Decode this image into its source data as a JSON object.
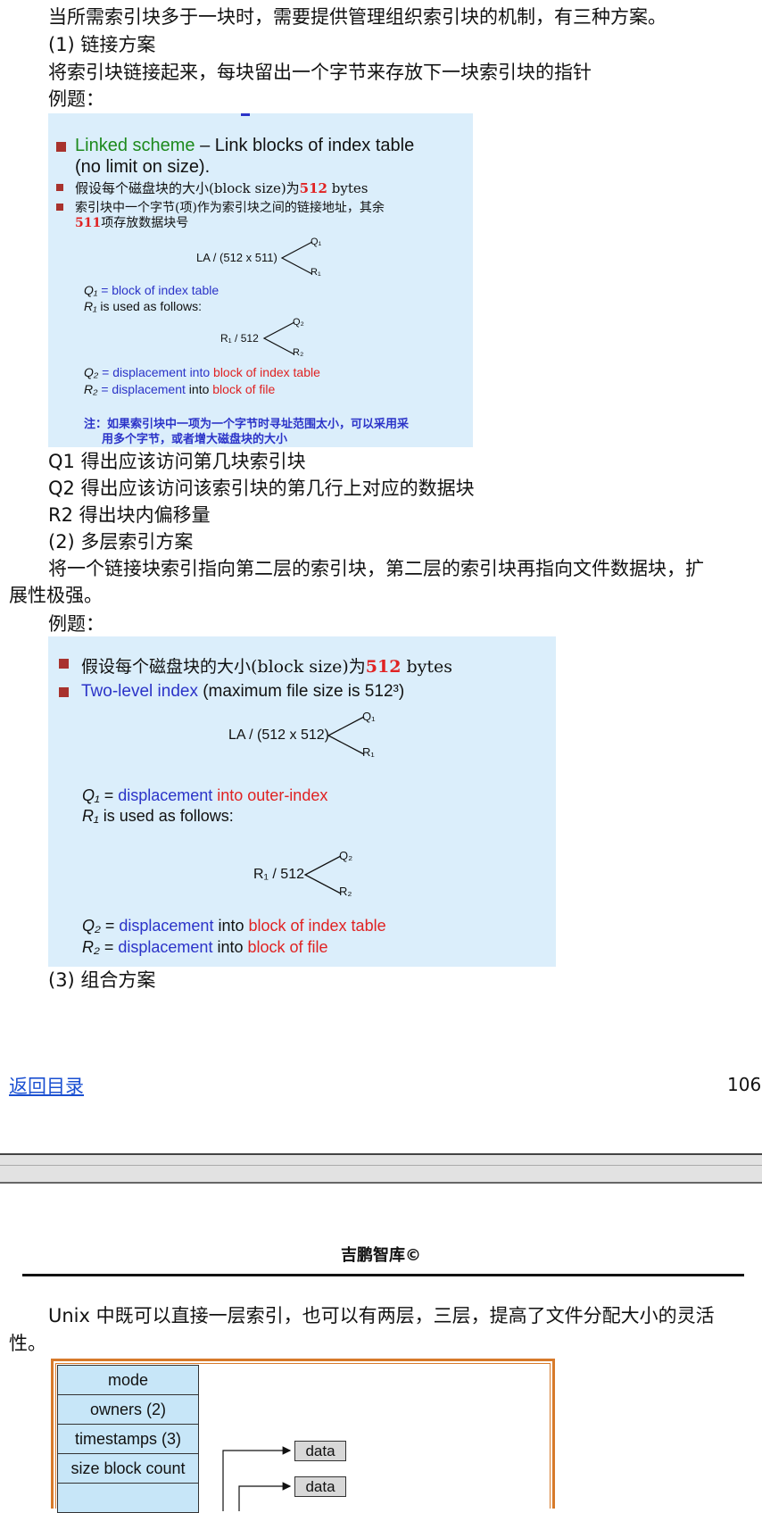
{
  "page1": {
    "intro": "当所需索引块多于一块时，需要提供管理组织索引块的机制，有三种方案。",
    "s1_title": "(1) 链接方案",
    "s1_desc": "将索引块链接起来，每块留出一个字节来存放下一块索引块的指针",
    "example1": "例题：",
    "slide1": {
      "linked": "Linked scheme",
      "dash": " – Link blocks of index table",
      "nolimit": "(no limit on size).",
      "b2_pre": "假设每个磁盘块的大小(block size)为",
      "b2_num": "512",
      "b2_post": " bytes",
      "b3_line1": "索引块中一个字节(项)作为索引块之间的链接地址，其余",
      "b3_num": "511",
      "b3_line2": "项存放数据块号",
      "la": "LA / (512 x 511)",
      "q1": "Q₁",
      "r1": "R₁",
      "q1_def_sym": "Q₁",
      "q1_def": " = block of index table",
      "r1_def_sym": "R₁",
      "r1_def": " is used as follows:",
      "r1_div": "R₁ / 512",
      "q2": "Q₂",
      "r2": "R₂",
      "q2_sym": "Q₂",
      "q2_a": " = displacement into ",
      "q2_b": "block of index table",
      "r2_sym": "R₂",
      "r2_a": " = displacement ",
      "r2_into": "into",
      "r2_b": " block of file",
      "note1": "注：如果索引块中一项为一个字节时寻址范围太小，可以采用采",
      "note2": "用多个字节，或者增大磁盘块的大小"
    },
    "q1_line": "Q1 得出应该访问第几块索引块",
    "q2_line": "Q2 得出应该访问该索引块的第几行上对应的数据块",
    "r2_line": "R2 得出块内偏移量",
    "s2_title": "(2) 多层索引方案",
    "s2_desc_1": "将一个链接块索引指向第二层的索引块，第二层的索引块再指向文件数据块，扩",
    "s2_desc_2": "展性极强。",
    "example2": "例题：",
    "slide2": {
      "b1_pre": "假设每个磁盘块的大小(block size)为",
      "b1_num": "512",
      "b1_post": " bytes",
      "b2_a": "Two-level index",
      "b2_b": " (maximum file size is 512³)",
      "la": "LA / (512 x 512)",
      "q1": "Q₁",
      "r1": "R₁",
      "q1_sym": "Q₁",
      "q1_eq": " = ",
      "q1_a": "displacement",
      "q1_b": " into outer-index",
      "r1_sym": "R₁",
      "r1_def": " is used as follows:",
      "r1_div": "R₁ / 512",
      "q2": "Q₂",
      "r2": "R₂",
      "q2_sym": "Q₂",
      "q2_eq": " = ",
      "q2_a": "displacement",
      "q2_into": " into ",
      "q2_b": "block of index table",
      "r2_sym": "R₂",
      "r2_eq": " = ",
      "r2_a": "displacement",
      "r2_into": " into ",
      "r2_b": "block of file"
    },
    "s3_title": "(3) 组合方案",
    "footer_link": "返回目录",
    "page_number": "106"
  },
  "page2": {
    "header": "吉鹏智库©",
    "unix_desc_1": "Unix 中既可以直接一层索引，也可以有两层，三层，提高了文件分配大小的灵活",
    "unix_desc_2": "性。",
    "inode_rows": [
      "mode",
      "owners (2)",
      "timestamps (3)",
      "size block count",
      ""
    ],
    "data_label": "data"
  },
  "colors": {
    "slide_bg": "#dbeefb",
    "bullet": "#a8322d",
    "blue": "#2b33c8",
    "red": "#e02222",
    "green": "#1d8a1d",
    "inode_frame": "#d77a2a",
    "inode_cell": "#c7e6f8"
  }
}
